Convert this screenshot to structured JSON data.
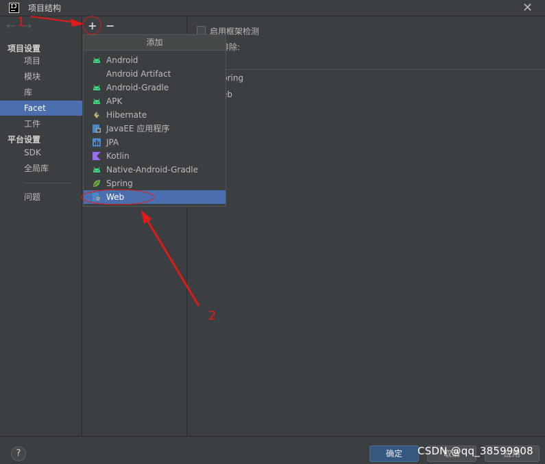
{
  "window": {
    "title": "项目结构",
    "logo_text": "IJ"
  },
  "nav": {
    "back": "←",
    "forward": "→"
  },
  "sidebar": {
    "groups": [
      "项目设置",
      "平台设置"
    ],
    "items": [
      "项目",
      "模块",
      "库",
      "Facet",
      "工件",
      "SDK",
      "全局库",
      "问题"
    ]
  },
  "toolbar": {
    "add": "+",
    "remove": "−"
  },
  "right": {
    "checkbox_label": "启用框架检测",
    "exclude_label": "排除:",
    "exclude_items": [
      "pring",
      "eb"
    ]
  },
  "popup": {
    "title": "添加",
    "items": [
      "Android",
      "Android Artifact",
      "Android-Gradle",
      "APK",
      "Hibernate",
      "JavaEE 应用程序",
      "JPA",
      "Kotlin",
      "Native-Android-Gradle",
      "Spring",
      "Web"
    ],
    "selected": "Web"
  },
  "buttons": {
    "ok": "确定",
    "cancel": "取消",
    "apply": "应用",
    "help": "?"
  },
  "annotations": {
    "one": "1",
    "two": "2"
  },
  "watermark": "CSDN @qq_38599908",
  "colors": {
    "selection": "#4b6eaf",
    "annotation": "#e31a1a",
    "android": "#3ddc84"
  }
}
